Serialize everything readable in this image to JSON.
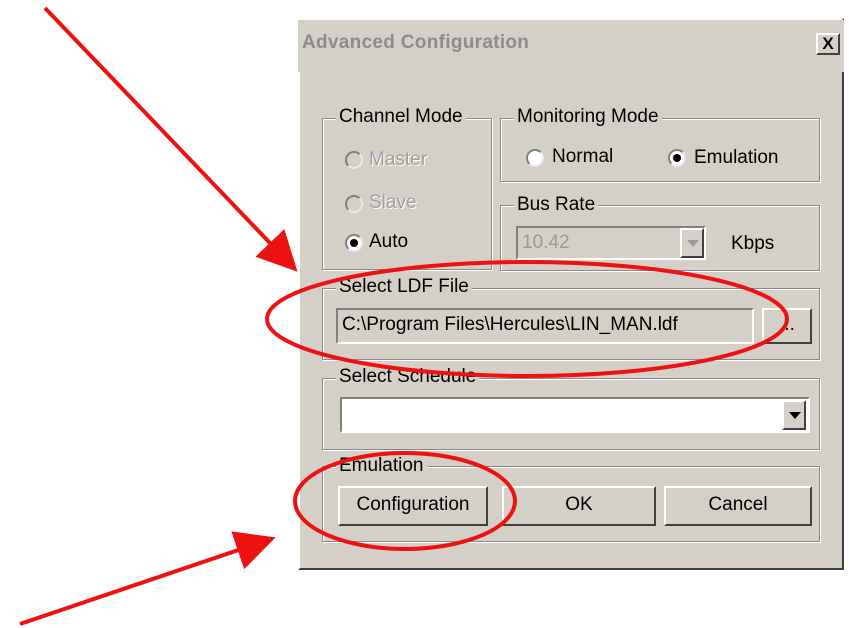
{
  "window": {
    "title": "Advanced Configuration",
    "close_label": "X"
  },
  "channel_mode": {
    "legend": "Channel Mode",
    "options": [
      {
        "label": "Master",
        "enabled": false,
        "selected": false
      },
      {
        "label": "Slave",
        "enabled": false,
        "selected": false
      },
      {
        "label": "Auto",
        "enabled": true,
        "selected": true
      }
    ]
  },
  "monitoring_mode": {
    "legend": "Monitoring Mode",
    "options": [
      {
        "label": "Normal",
        "selected": false
      },
      {
        "label": "Emulation",
        "selected": true
      }
    ]
  },
  "bus_rate": {
    "legend": "Bus Rate",
    "value": "10.42",
    "unit": "Kbps"
  },
  "ldf_file": {
    "legend": "Select LDF File",
    "path": "C:\\Program Files\\Hercules\\LIN_MAN.ldf",
    "browse_label": "..."
  },
  "schedule": {
    "legend": "Select Schedule",
    "value": ""
  },
  "emulation": {
    "legend": "Emulation",
    "configuration_label": "Configuration"
  },
  "buttons": {
    "ok_label": "OK",
    "cancel_label": "Cancel"
  },
  "annotation": {
    "color": "#ee1111"
  }
}
